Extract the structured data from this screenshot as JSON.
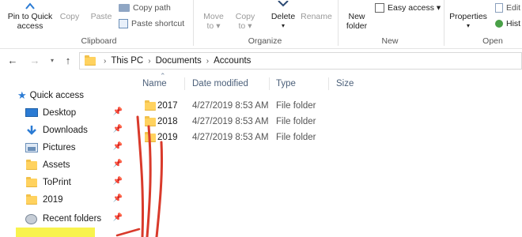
{
  "ribbon": {
    "clipboard": {
      "pin_label_1": "Pin to Quick",
      "pin_label_2": "access",
      "copy": "Copy",
      "paste": "Paste",
      "copy_path": "Copy path",
      "paste_shortcut": "Paste shortcut",
      "group": "Clipboard"
    },
    "organize": {
      "move_to_1": "Move",
      "move_to_2": "to ▾",
      "copy_to_1": "Copy",
      "copy_to_2": "to ▾",
      "delete": "Delete",
      "delete_arrow": "▾",
      "rename": "Rename",
      "group": "Organize"
    },
    "new": {
      "new_folder_1": "New",
      "new_folder_2": "folder",
      "easy_access": "Easy access ▾",
      "group": "New"
    },
    "open": {
      "properties": "Properties",
      "properties_arrow": "▾",
      "edit": "Edit",
      "history": "Hist",
      "group": "Open"
    }
  },
  "address": {
    "crumbs": [
      "This PC",
      "Documents",
      "Accounts"
    ],
    "separator": "›"
  },
  "nav": {
    "quick_access": "Quick access",
    "items": [
      {
        "label": "Desktop",
        "icon": "desktop-icon",
        "pinned": true
      },
      {
        "label": "Downloads",
        "icon": "download-icon",
        "pinned": true
      },
      {
        "label": "Pictures",
        "icon": "pictures-icon",
        "pinned": true
      },
      {
        "label": "Assets",
        "icon": "folder-icon",
        "pinned": true
      },
      {
        "label": "ToPrint",
        "icon": "folder-icon",
        "pinned": true
      },
      {
        "label": "2019",
        "icon": "folder-icon",
        "pinned": true
      },
      {
        "label": "Recent folders",
        "icon": "recent-folders-icon",
        "pinned": true
      }
    ]
  },
  "columns": {
    "name": "Name",
    "date_modified": "Date modified",
    "type": "Type",
    "size": "Size"
  },
  "files": [
    {
      "name": "2017",
      "date": "4/27/2019 8:53 AM",
      "type": "File folder"
    },
    {
      "name": "2018",
      "date": "4/27/2019 8:53 AM",
      "type": "File folder"
    },
    {
      "name": "2019",
      "date": "4/27/2019 8:53 AM",
      "type": "File folder"
    }
  ],
  "colors": {
    "annotation_red": "#d93a2b",
    "highlight_yellow": "#f7f23a",
    "folder_yellow": "#ffd25f",
    "accent_blue": "#2b7bd4"
  }
}
